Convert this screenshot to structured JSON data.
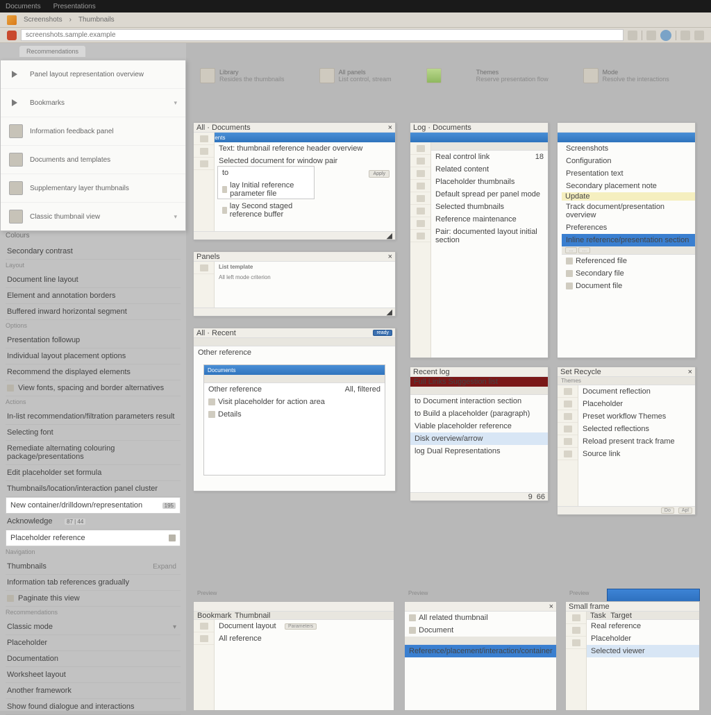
{
  "topbar": {
    "item1": "Documents",
    "item2": "Presentations"
  },
  "breadcrumb": {
    "seg1": "Screenshots",
    "sep": "›",
    "seg2": "Thumbnails"
  },
  "address": {
    "placeholder": "screenshots.sample.example"
  },
  "sidebar": {
    "tab": "Recommendations",
    "popout": [
      {
        "label": "Panel layout representation overview"
      },
      {
        "label": "Bookmarks"
      },
      {
        "label": "Information feedback panel"
      },
      {
        "label": "Documents and templates"
      },
      {
        "label": "Supplementary layer thumbnails"
      },
      {
        "label": "Classic thumbnail view"
      }
    ],
    "sections": {
      "s1": "Colours",
      "i1": "Secondary contrast",
      "sub1": "Layout",
      "i2": "Document line layout",
      "i3": "Element and annotation borders",
      "i4": "Buffered inward horizontal segment",
      "sub2": "Options",
      "i5": "Presentation followup",
      "i6": "Individual layout placement options",
      "i7": "Recommend the displayed elements",
      "i8": "View fonts, spacing and border alternatives",
      "sub3": "Actions",
      "i9": "In-list recommendation/filtration parameters result",
      "i10": "Selecting font",
      "i12": "Remediate alternating colouring package/presentations",
      "i13": "Edit placeholder set formula",
      "i14": "Thumbnails/location/interaction panel cluster",
      "i15": "New container/drilldown/representation",
      "i15b": "195",
      "i16": "Acknowledge",
      "i16b": "87 | 44",
      "i17": "Placeholder reference",
      "sub4": "Navigation",
      "i18": "Thumbnails",
      "i18r": "Expand",
      "i19": "Information tab references gradually",
      "i20": "Paginate this view",
      "sub5": "Recommendations",
      "i21": "Classic mode",
      "i22": "Placeholder",
      "i23": "Documentation",
      "i24": "Worksheet layout",
      "i25": "Another framework",
      "i26": "Show found dialogue and interactions"
    }
  },
  "ribbon": [
    {
      "t1": "Library",
      "t2": "Resides the thumbnails"
    },
    {
      "t1": "All panels",
      "t2": "List control, stream"
    },
    {
      "t1": "",
      "t2": ""
    },
    {
      "t1": "Themes",
      "t2": "Reserve presentation flow"
    },
    {
      "t1": "Mode",
      "t2": "Resolve the interactions"
    }
  ],
  "thumbs": {
    "t1": {
      "title": "All · Documents",
      "blue": "Documents",
      "l1": "Text: thumbnail reference header overview",
      "l2": "Selected document for window pair",
      "l3": "to",
      "l4": "lay  Initial reference parameter file",
      "l5": "lay  Second staged reference buffer",
      "btn": "Apply"
    },
    "t2": {
      "title": "Log · Documents",
      "l1": "Real control link",
      "l2": "Related content",
      "l3": "Placeholder thumbnails",
      "l4": "Default spread per panel mode",
      "l5": "Selected thumbnails",
      "l6": "Reference maintenance",
      "l7": "Pair: documented layout initial section",
      "v": "18"
    },
    "t3": {
      "title": "",
      "h1": "Screenshots",
      "h2": "Configuration",
      "l1": "Presentation text",
      "l2": "Secondary placement note",
      "l3": "Update",
      "l4": "Track document/presentation overview",
      "l5": "Preferences",
      "sel": "Inline reference/presentation section",
      "l6": "Referenced file",
      "l7": "Secondary file",
      "l8": "Document file"
    },
    "t4": {
      "title": "Panels",
      "h": "List template",
      "l1": "All left mode criterion"
    },
    "t5": {
      "title": "All · Recent",
      "blue": "Documents",
      "l1": "Other reference",
      "l1b": "All, filtered",
      "l2": "Visit placeholder for action area",
      "l3": "Details"
    },
    "t6": {
      "title": "Recent log",
      "dark": "Full Links Suggestion list",
      "l1": "to  Document interaction section",
      "l2": "to  Build a placeholder (paragraph)",
      "l3": "Viable placeholder reference",
      "sel": "Disk overview/arrow",
      "l5": "log  Dual  Representations",
      "foot1": "9",
      "foot2": "66"
    },
    "t7": {
      "title": "Set   Recycle",
      "l1": "Themes",
      "l2": "Document reflection",
      "l3": "Placeholder",
      "l4": "Preset  workflow Themes",
      "l5": "Selected reflections",
      "l6": "Reload  present  track  frame",
      "l7": "Source  link",
      "foot1": "Do",
      "foot2": "Apl"
    },
    "t8": {
      "cap": "Preview",
      "l1": "Bookmark",
      "l2": "Thumbnail",
      "h": "Document layout",
      "h2": "Parameters",
      "l3": "All reference"
    },
    "t9": {
      "cap": "Preview",
      "l1": "All related  thumbnail",
      "l2": "Document",
      "sel": "Reference/placement/interaction/container"
    },
    "t10": {
      "cap": "Preview",
      "l1": "Small frame",
      "h1": "Task",
      "h2": "Target",
      "l2": "Real  reference",
      "l3": "Placeholder",
      "sel": "Selected viewer"
    }
  }
}
